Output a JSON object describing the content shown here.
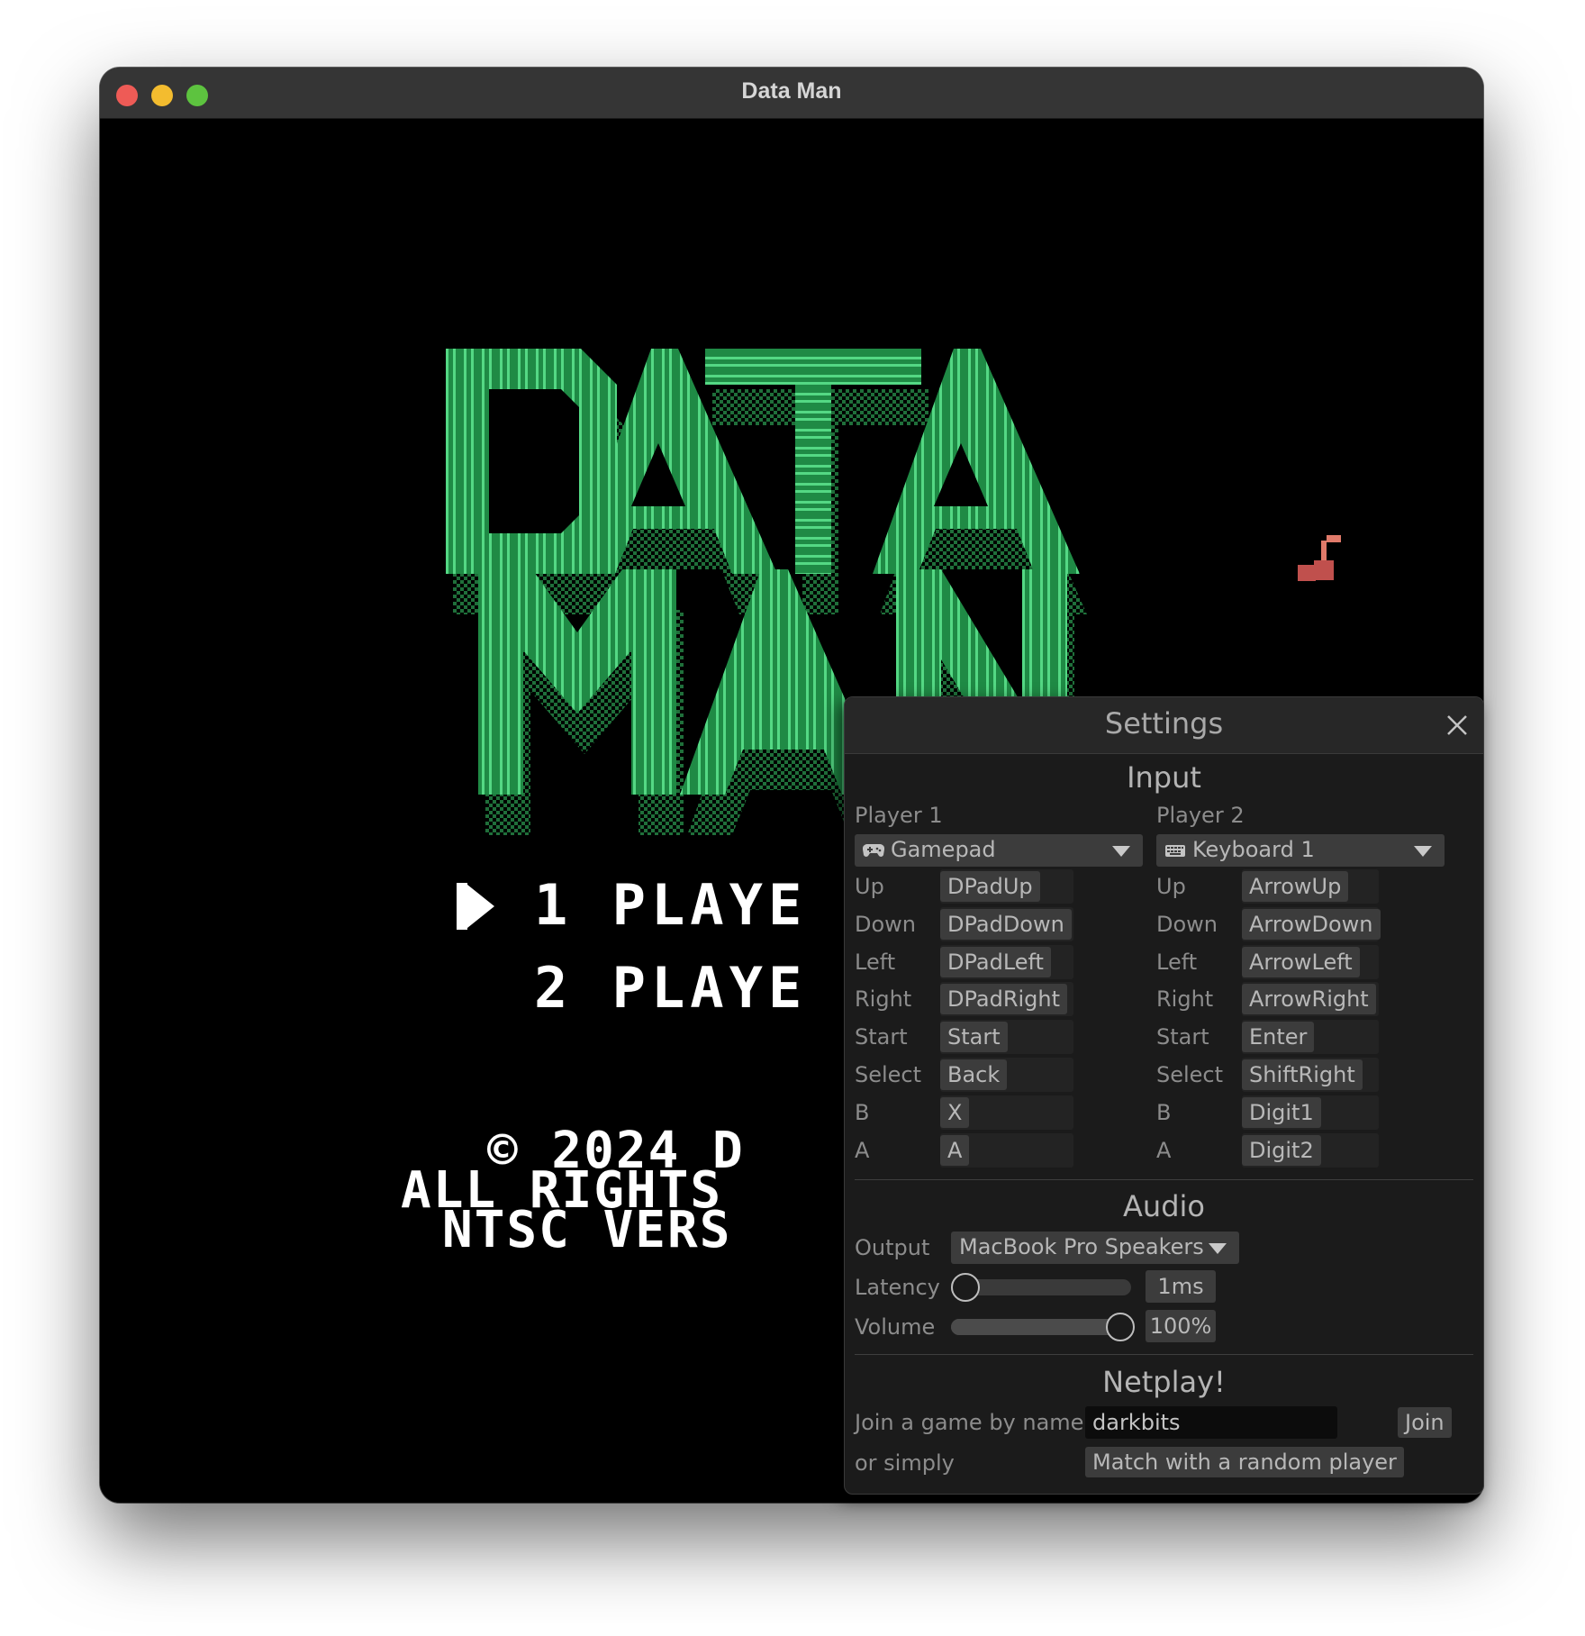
{
  "window": {
    "title": "Data Man"
  },
  "game": {
    "menu": {
      "option1": "1 PLAYE",
      "option2": "2 PLAYE"
    },
    "copyright": {
      "line1": "© 2024 D",
      "line2": "ALL RIGHTS",
      "line3": "NTSC VERS"
    },
    "logo": {
      "line1": "DATA",
      "line2": "MAN"
    },
    "colors": {
      "logo_green": "#1f8a45",
      "logo_dark": "#0f4a25",
      "stripe": "#4fd57e",
      "cherry": "#c0504d"
    }
  },
  "settings": {
    "title": "Settings",
    "input": {
      "title": "Input",
      "player1": {
        "label": "Player 1",
        "device": "Gamepad",
        "device_icon": "gamepad-icon",
        "bindings": [
          {
            "action": "Up",
            "key": "DPadUp"
          },
          {
            "action": "Down",
            "key": "DPadDown"
          },
          {
            "action": "Left",
            "key": "DPadLeft"
          },
          {
            "action": "Right",
            "key": "DPadRight"
          },
          {
            "action": "Start",
            "key": "Start"
          },
          {
            "action": "Select",
            "key": "Back"
          },
          {
            "action": "B",
            "key": "X"
          },
          {
            "action": "A",
            "key": "A"
          }
        ]
      },
      "player2": {
        "label": "Player 2",
        "device": "Keyboard 1",
        "device_icon": "keyboard-icon",
        "bindings": [
          {
            "action": "Up",
            "key": "ArrowUp"
          },
          {
            "action": "Down",
            "key": "ArrowDown"
          },
          {
            "action": "Left",
            "key": "ArrowLeft"
          },
          {
            "action": "Right",
            "key": "ArrowRight"
          },
          {
            "action": "Start",
            "key": "Enter"
          },
          {
            "action": "Select",
            "key": "ShiftRight"
          },
          {
            "action": "B",
            "key": "Digit1"
          },
          {
            "action": "A",
            "key": "Digit2"
          }
        ]
      }
    },
    "audio": {
      "title": "Audio",
      "output_label": "Output",
      "output_value": "MacBook Pro Speakers",
      "latency_label": "Latency",
      "latency_value": "1ms",
      "latency_fraction": 0.0,
      "volume_label": "Volume",
      "volume_value": "100%",
      "volume_fraction": 1.0
    },
    "netplay": {
      "title": "Netplay!",
      "join_label": "Join a game by name",
      "join_value": "darkbits",
      "join_button": "Join",
      "or_label": "or simply",
      "random_button": "Match with a random player"
    }
  }
}
